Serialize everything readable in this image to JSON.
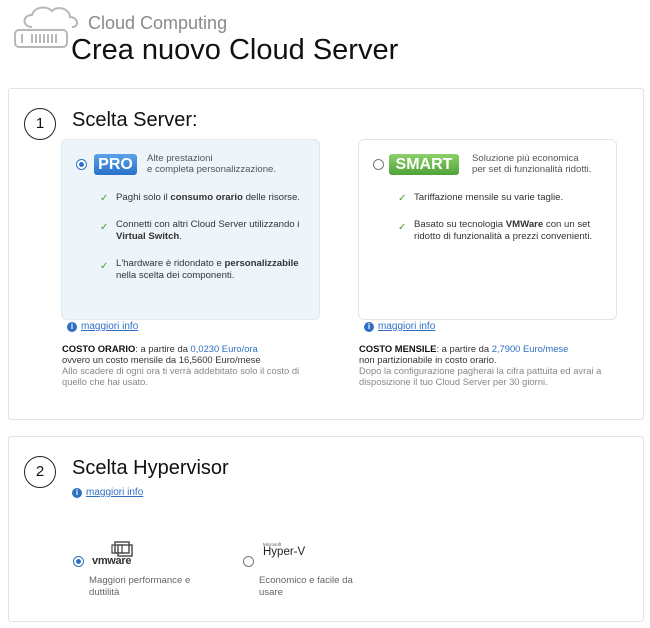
{
  "header": {
    "brand": "Cloud Computing",
    "title": "Crea nuovo Cloud Server"
  },
  "section1": {
    "step": "1",
    "title": "Scelta Server:",
    "pro": {
      "selected": true,
      "badge": "PRO",
      "desc1": "Alte prestazioni",
      "desc2": "e completa personalizzazione.",
      "features": [
        {
          "pre": "Paghi solo il ",
          "bold": "consumo orario",
          "post": " delle risorse."
        },
        {
          "line1": "Connetti con altri Cloud Server utilizzando i",
          "bold": "Virtual Switch",
          "post": "."
        },
        {
          "pre": "L'hardware è ridondato e ",
          "bold": "personalizzabile",
          "line2": "nella scelta dei componenti."
        }
      ],
      "info": "maggiori info",
      "price_label": "COSTO ORARIO",
      "price_pre": ": a partire da ",
      "price_value": "0,0230 Euro/ora",
      "price_line2": "ovvero un costo mensile da 16,5600 Euro/mese",
      "price_note1": "Allo scadere di ogni ora ti verrà addebitato solo il costo di",
      "price_note2": "quello che hai usato."
    },
    "smart": {
      "selected": false,
      "badge": "SMART",
      "desc1": "Soluzione più economica",
      "desc2": "per set di funzionalità ridotti.",
      "features": [
        {
          "text": "Tariffazione mensile su varie taglie."
        },
        {
          "pre": "Basato su tecnologia ",
          "bold": "VMWare",
          "post": " con un set",
          "line2": "ridotto di funzionalità a prezzi convenienti."
        }
      ],
      "info": "maggiori info",
      "price_label": "COSTO MENSILE",
      "price_pre": ": a partire da ",
      "price_value": "2,7900 Euro/mese",
      "price_line2": "non partizionabile in costo orario.",
      "price_note1": "Dopo la configurazione pagherai la cifra pattuita ed avrai a",
      "price_note2": "disposizione il tuo Cloud Server per 30 giorni."
    }
  },
  "section2": {
    "step": "2",
    "title": "Scelta Hypervisor",
    "info": "maggiori info",
    "vmware": {
      "selected": true,
      "logo": "vmware",
      "desc1": "Maggiori performance e",
      "desc2": "duttilità"
    },
    "hyperv": {
      "selected": false,
      "logo_small": "Microsoft",
      "logo": "Hyper-V",
      "desc1": "Economico e facile da",
      "desc2": "usare"
    }
  },
  "colors": {
    "accent": "#2f6fc3",
    "pro_badge": "#3a85d6",
    "smart_badge": "#5cb043",
    "check": "#4a9a2e"
  }
}
